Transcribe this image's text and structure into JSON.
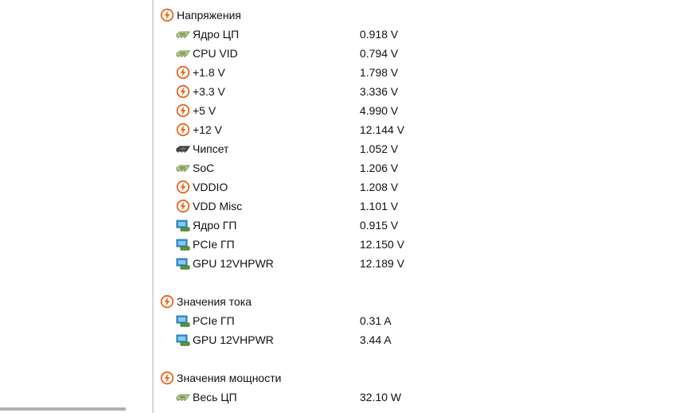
{
  "sections": [
    {
      "title": "Напряжения",
      "icon": "lightning-icon",
      "items": [
        {
          "label": "Ядро ЦП",
          "value": "0.918 V",
          "icon": "cpu-chip-icon"
        },
        {
          "label": "CPU VID",
          "value": "0.794 V",
          "icon": "cpu-chip-icon"
        },
        {
          "label": "+1.8 V",
          "value": "1.798 V",
          "icon": "lightning-icon"
        },
        {
          "label": "+3.3 V",
          "value": "3.336 V",
          "icon": "lightning-icon"
        },
        {
          "label": "+5 V",
          "value": "4.990 V",
          "icon": "lightning-icon"
        },
        {
          "label": "+12 V",
          "value": "12.144 V",
          "icon": "lightning-icon"
        },
        {
          "label": "Чипсет",
          "value": "1.052 V",
          "icon": "chipset-icon"
        },
        {
          "label": "SoC",
          "value": "1.206 V",
          "icon": "cpu-chip-icon"
        },
        {
          "label": "VDDIO",
          "value": "1.208 V",
          "icon": "lightning-icon"
        },
        {
          "label": "VDD Misc",
          "value": "1.101 V",
          "icon": "lightning-icon"
        },
        {
          "label": "Ядро ГП",
          "value": "0.915 V",
          "icon": "gpu-icon"
        },
        {
          "label": "PCIe ГП",
          "value": "12.150 V",
          "icon": "gpu-icon"
        },
        {
          "label": "GPU 12VHPWR",
          "value": "12.189 V",
          "icon": "gpu-icon"
        }
      ]
    },
    {
      "title": "Значения тока",
      "icon": "lightning-icon",
      "items": [
        {
          "label": "PCIe ГП",
          "value": "0.31 A",
          "icon": "gpu-icon"
        },
        {
          "label": "GPU 12VHPWR",
          "value": "3.44 A",
          "icon": "gpu-icon"
        }
      ]
    },
    {
      "title": "Значения мощности",
      "icon": "lightning-icon",
      "items": [
        {
          "label": "Весь ЦП",
          "value": "32.10 W",
          "icon": "cpu-chip-icon"
        }
      ]
    }
  ],
  "colors": {
    "lightning_orange": "#e8641b",
    "chip_green": "#7a9a52",
    "chipset_dark": "#4a4a4a",
    "gpu_blue": "#3a9ad9",
    "gpu_green": "#5a9a3a"
  }
}
